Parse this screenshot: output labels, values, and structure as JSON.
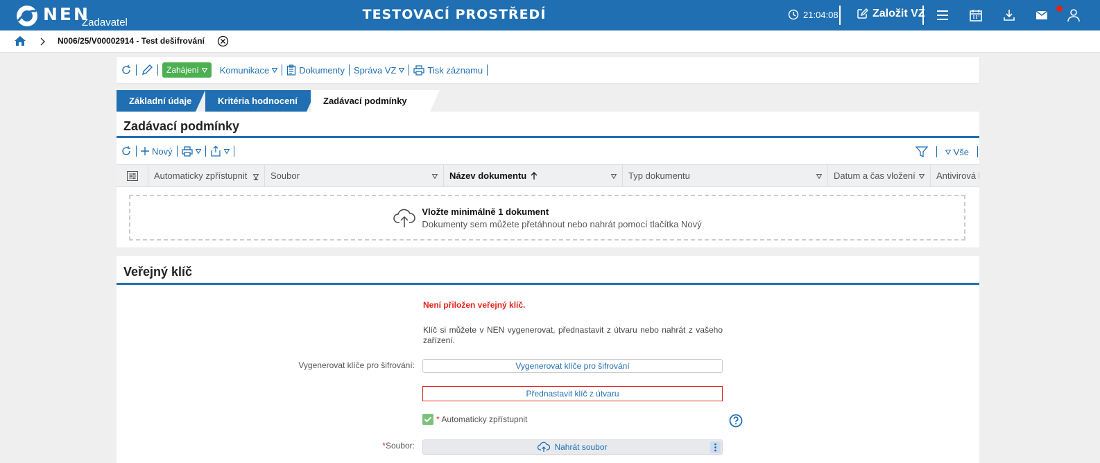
{
  "header": {
    "logo_text": "NEN",
    "logo_sub": "Zadavatel",
    "env_title": "TESTOVACÍ PROSTŘEDÍ",
    "clock": "21:04:08",
    "create_label": "Založit VZ",
    "accent": "#1f6fb2"
  },
  "breadcrumb": {
    "path": "N006/25/V00002914 - Test dešifrování"
  },
  "actions": {
    "start_label": "Zahájení",
    "communication_label": "Komunikace",
    "documents_label": "Dokumenty",
    "manage_label": "Správa VZ",
    "print_label": "Tisk záznamu"
  },
  "tabs": [
    {
      "label": "Základní údaje"
    },
    {
      "label": "Kritéria hodnocení"
    },
    {
      "label": "Zadávací podmínky"
    }
  ],
  "conditions": {
    "title": "Zadávací podmínky",
    "new_label": "Nový",
    "all_label": "Vše",
    "columns": [
      "Automaticky zpřístupnit",
      "Soubor",
      "Název dokumentu",
      "Typ dokumentu",
      "Datum a čas vložení",
      "Antivirová k"
    ],
    "drop_main": "Vložte minimálně 1 dokument",
    "drop_sub": "Dokumenty sem můžete přetáhnout nebo nahrát pomocí tlačítka Nový"
  },
  "public_key": {
    "title": "Veřejný klíč",
    "warning": "Není přiložen veřejný klíč.",
    "info": "Klíč si můžete v NEN vygenerovat, přednastavit z útvaru nebo nahrát z vašeho zařízení.",
    "generate_label": "Vygenerovat klíče pro šifrování:",
    "generate_button": "Vygenerovat klíče pro šifrování",
    "preset_button": "Přednastavit klíč z útvaru",
    "auto_label": "Automaticky zpřístupnit",
    "file_label": "Soubor:",
    "upload_button": "Nahrát soubor"
  }
}
